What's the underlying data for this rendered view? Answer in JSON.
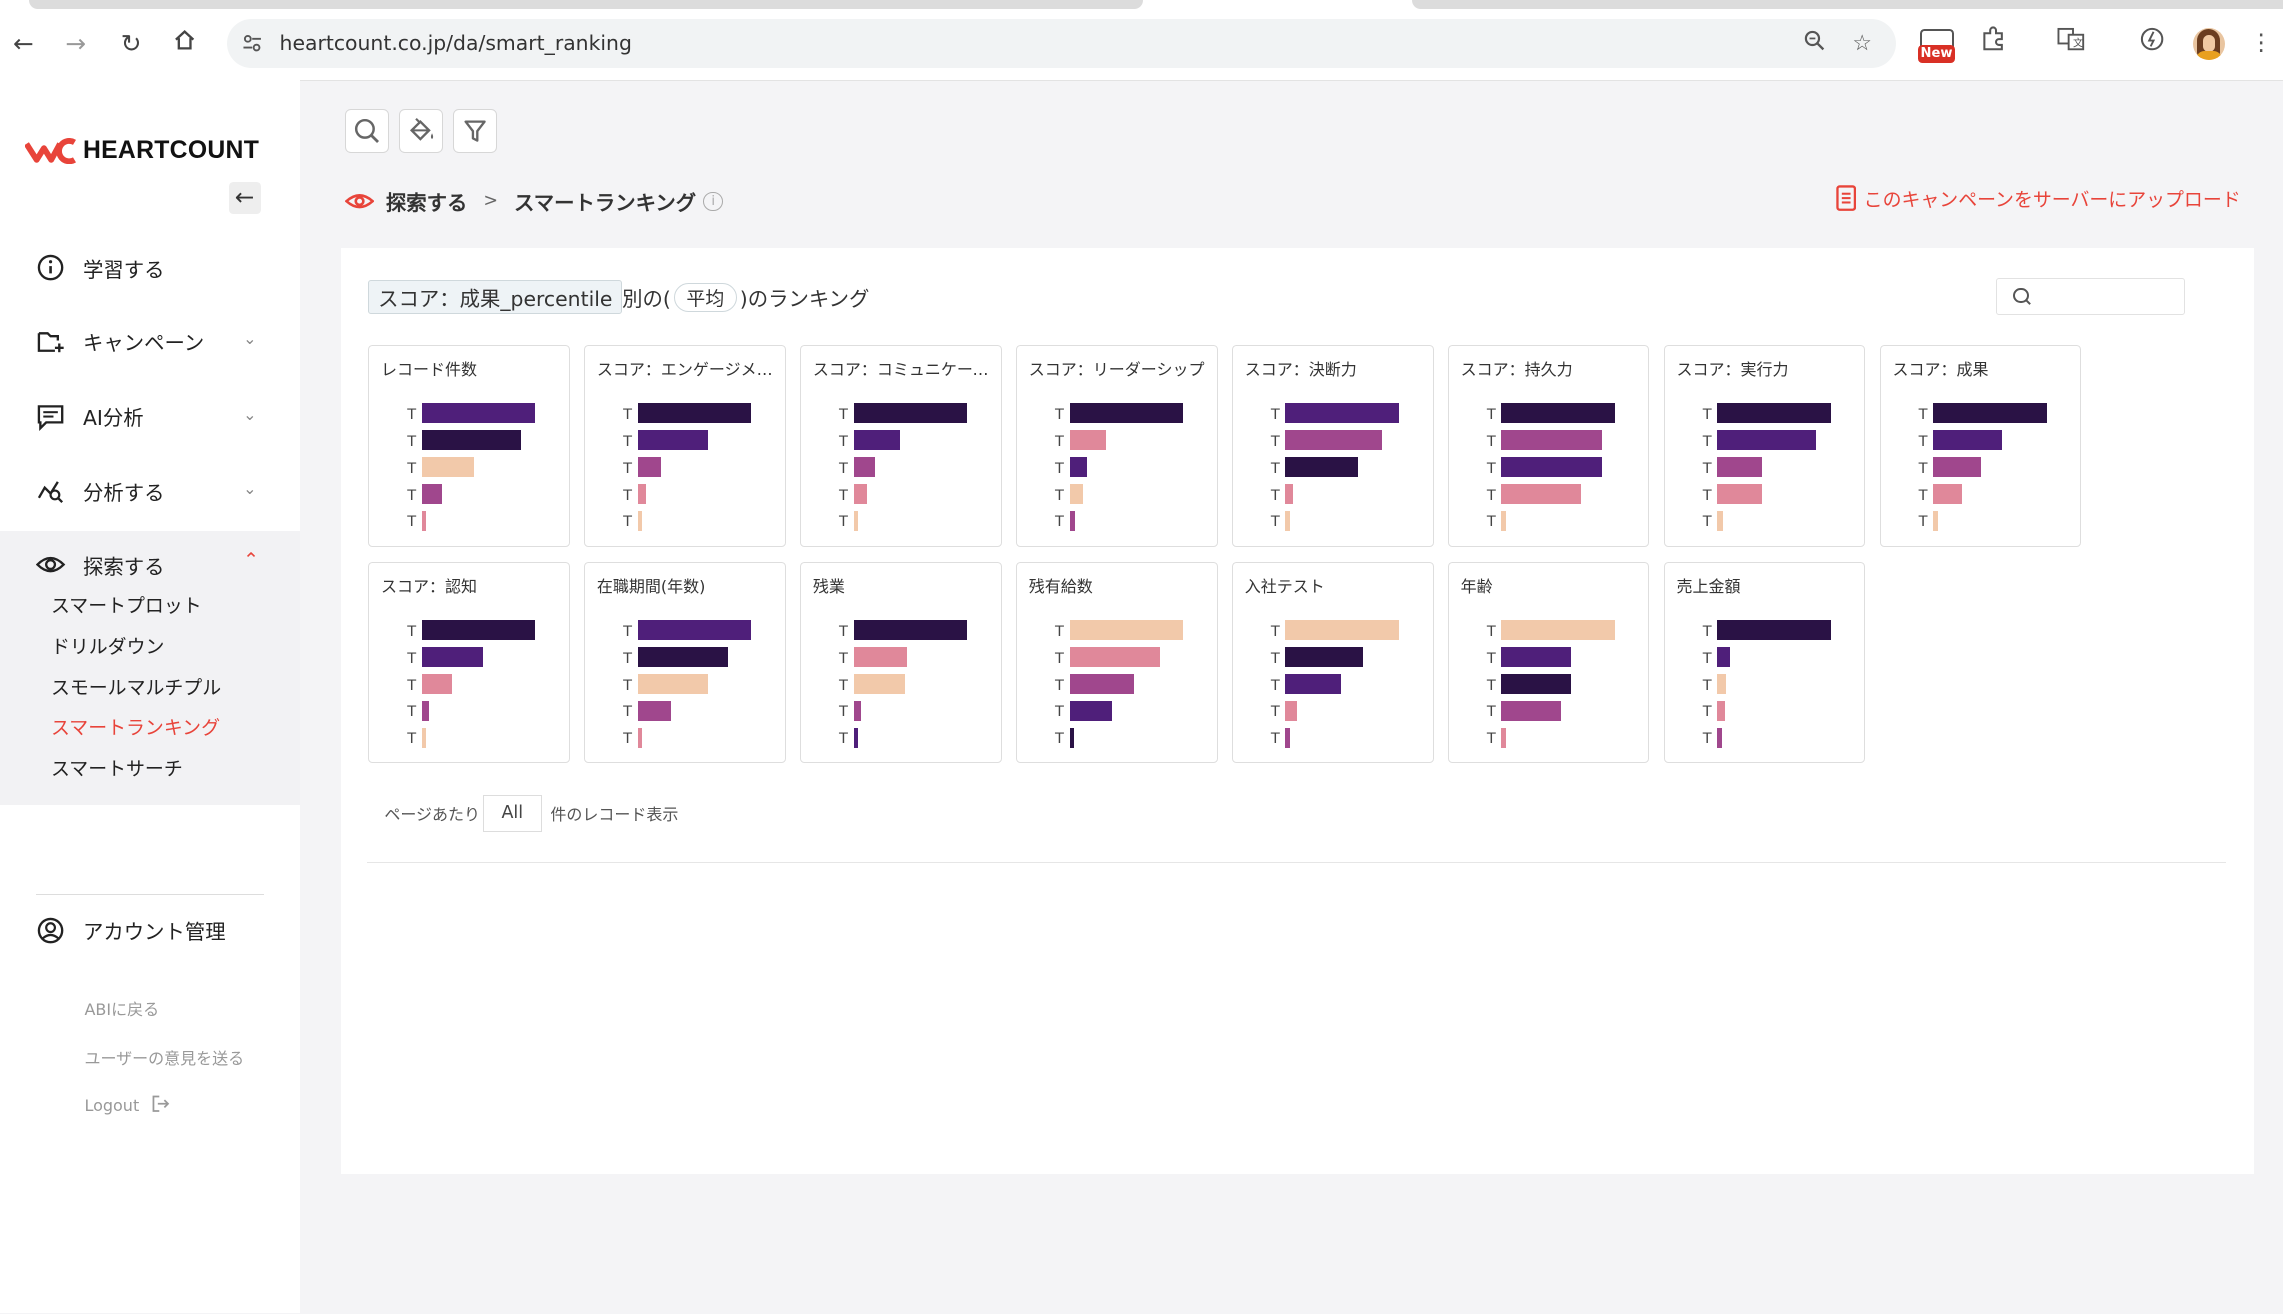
{
  "browser": {
    "url": "heartcount.co.jp/da/smart_ranking",
    "new_badge": "New"
  },
  "app": {
    "logo_text": "HEARTCOUNT",
    "menu": [
      {
        "label": "学習する"
      },
      {
        "label": "キャンペーン"
      },
      {
        "label": "AI分析"
      },
      {
        "label": "分析する"
      },
      {
        "label": "探索する"
      }
    ],
    "explore_sub": [
      {
        "label": "スマートプロット"
      },
      {
        "label": "ドリルダウン"
      },
      {
        "label": "スモールマルチプル"
      },
      {
        "label": "スマートランキング"
      },
      {
        "label": "スマートサーチ"
      }
    ],
    "account": "アカウント管理",
    "links": {
      "back": "ABIに戻る",
      "feedback": "ユーザーの意見を送る",
      "logout": "Logout"
    }
  },
  "breadcrumb": {
    "root": "探索する",
    "sep": ">",
    "current": "スマートランキング"
  },
  "upload_label": "このキャンペーンをサーバーにアップロード",
  "ranking": {
    "metric": "スコア：成果_percentile",
    "by": "別の(",
    "agg": "平均",
    "suffix": ")のランキング"
  },
  "pager": {
    "prefix": "ページあたり",
    "value": "All",
    "suffix": "件のレコード表示"
  },
  "colors": {
    "c1": "#2a1245",
    "c2": "#4f1f7a",
    "c3": "#a0478d",
    "c4": "#e0889a",
    "c5": "#f2c9aa",
    "accent": "#e8443a"
  },
  "chart_data": {
    "type": "bar",
    "note_labels": "each bar row is labeled T",
    "cards": [
      {
        "title": "レコード件数",
        "bars": [
          {
            "label": "T",
            "value": 1.0,
            "color": "#4f1f7a"
          },
          {
            "label": "T",
            "value": 0.87,
            "color": "#2a1245"
          },
          {
            "label": "T",
            "value": 0.46,
            "color": "#f2c9aa"
          },
          {
            "label": "T",
            "value": 0.18,
            "color": "#a0478d"
          },
          {
            "label": "T",
            "value": 0.04,
            "color": "#e0889a"
          }
        ]
      },
      {
        "title": "スコア：エンゲージメント",
        "bars": [
          {
            "label": "T",
            "value": 1.0,
            "color": "#2a1245"
          },
          {
            "label": "T",
            "value": 0.62,
            "color": "#4f1f7a"
          },
          {
            "label": "T",
            "value": 0.2,
            "color": "#a0478d"
          },
          {
            "label": "T",
            "value": 0.08,
            "color": "#e0889a"
          },
          {
            "label": "T",
            "value": 0.04,
            "color": "#f2c9aa"
          }
        ]
      },
      {
        "title": "スコア：コミュニケーション",
        "bars": [
          {
            "label": "T",
            "value": 1.0,
            "color": "#2a1245"
          },
          {
            "label": "T",
            "value": 0.41,
            "color": "#4f1f7a"
          },
          {
            "label": "T",
            "value": 0.19,
            "color": "#a0478d"
          },
          {
            "label": "T",
            "value": 0.12,
            "color": "#e0889a"
          },
          {
            "label": "T",
            "value": 0.04,
            "color": "#f2c9aa"
          }
        ]
      },
      {
        "title": "スコア：リーダーシップ",
        "bars": [
          {
            "label": "T",
            "value": 1.0,
            "color": "#2a1245"
          },
          {
            "label": "T",
            "value": 0.32,
            "color": "#e0889a"
          },
          {
            "label": "T",
            "value": 0.15,
            "color": "#4f1f7a"
          },
          {
            "label": "T",
            "value": 0.12,
            "color": "#f2c9aa"
          },
          {
            "label": "T",
            "value": 0.05,
            "color": "#a0478d"
          }
        ]
      },
      {
        "title": "スコア：決断力",
        "bars": [
          {
            "label": "T",
            "value": 1.0,
            "color": "#4f1f7a"
          },
          {
            "label": "T",
            "value": 0.84,
            "color": "#a0478d"
          },
          {
            "label": "T",
            "value": 0.64,
            "color": "#2a1245"
          },
          {
            "label": "T",
            "value": 0.07,
            "color": "#e0889a"
          },
          {
            "label": "T",
            "value": 0.04,
            "color": "#f2c9aa"
          }
        ]
      },
      {
        "title": "スコア：持久力",
        "bars": [
          {
            "label": "T",
            "value": 1.0,
            "color": "#2a1245"
          },
          {
            "label": "T",
            "value": 0.88,
            "color": "#a0478d"
          },
          {
            "label": "T",
            "value": 0.88,
            "color": "#4f1f7a"
          },
          {
            "label": "T",
            "value": 0.71,
            "color": "#e0889a"
          },
          {
            "label": "T",
            "value": 0.04,
            "color": "#f2c9aa"
          }
        ]
      },
      {
        "title": "スコア：実行力",
        "bars": [
          {
            "label": "T",
            "value": 1.0,
            "color": "#2a1245"
          },
          {
            "label": "T",
            "value": 0.87,
            "color": "#4f1f7a"
          },
          {
            "label": "T",
            "value": 0.4,
            "color": "#a0478d"
          },
          {
            "label": "T",
            "value": 0.4,
            "color": "#e0889a"
          },
          {
            "label": "T",
            "value": 0.05,
            "color": "#f2c9aa"
          }
        ]
      },
      {
        "title": "スコア：成果",
        "bars": [
          {
            "label": "T",
            "value": 1.0,
            "color": "#2a1245"
          },
          {
            "label": "T",
            "value": 0.6,
            "color": "#4f1f7a"
          },
          {
            "label": "T",
            "value": 0.42,
            "color": "#a0478d"
          },
          {
            "label": "T",
            "value": 0.26,
            "color": "#e0889a"
          },
          {
            "label": "T",
            "value": 0.04,
            "color": "#f2c9aa"
          }
        ]
      },
      {
        "title": "スコア：認知",
        "bars": [
          {
            "label": "T",
            "value": 1.0,
            "color": "#2a1245"
          },
          {
            "label": "T",
            "value": 0.54,
            "color": "#4f1f7a"
          },
          {
            "label": "T",
            "value": 0.27,
            "color": "#e0889a"
          },
          {
            "label": "T",
            "value": 0.06,
            "color": "#a0478d"
          },
          {
            "label": "T",
            "value": 0.04,
            "color": "#f2c9aa"
          }
        ]
      },
      {
        "title": "在職期間(年数)",
        "bars": [
          {
            "label": "T",
            "value": 1.0,
            "color": "#4f1f7a"
          },
          {
            "label": "T",
            "value": 0.8,
            "color": "#2a1245"
          },
          {
            "label": "T",
            "value": 0.62,
            "color": "#f2c9aa"
          },
          {
            "label": "T",
            "value": 0.3,
            "color": "#a0478d"
          },
          {
            "label": "T",
            "value": 0.04,
            "color": "#e0889a"
          }
        ]
      },
      {
        "title": "残業",
        "bars": [
          {
            "label": "T",
            "value": 1.0,
            "color": "#2a1245"
          },
          {
            "label": "T",
            "value": 0.48,
            "color": "#e0889a"
          },
          {
            "label": "T",
            "value": 0.45,
            "color": "#f2c9aa"
          },
          {
            "label": "T",
            "value": 0.07,
            "color": "#a0478d"
          },
          {
            "label": "T",
            "value": 0.04,
            "color": "#4f1f7a"
          }
        ]
      },
      {
        "title": "残有給数",
        "bars": [
          {
            "label": "T",
            "value": 1.0,
            "color": "#f2c9aa"
          },
          {
            "label": "T",
            "value": 0.8,
            "color": "#e0889a"
          },
          {
            "label": "T",
            "value": 0.57,
            "color": "#a0478d"
          },
          {
            "label": "T",
            "value": 0.37,
            "color": "#4f1f7a"
          },
          {
            "label": "T",
            "value": 0.04,
            "color": "#2a1245"
          }
        ]
      },
      {
        "title": "入社テスト",
        "bars": [
          {
            "label": "T",
            "value": 1.0,
            "color": "#f2c9aa"
          },
          {
            "label": "T",
            "value": 0.68,
            "color": "#2a1245"
          },
          {
            "label": "T",
            "value": 0.49,
            "color": "#4f1f7a"
          },
          {
            "label": "T",
            "value": 0.1,
            "color": "#e0889a"
          },
          {
            "label": "T",
            "value": 0.04,
            "color": "#a0478d"
          }
        ]
      },
      {
        "title": "年齢",
        "bars": [
          {
            "label": "T",
            "value": 1.0,
            "color": "#f2c9aa"
          },
          {
            "label": "T",
            "value": 0.62,
            "color": "#4f1f7a"
          },
          {
            "label": "T",
            "value": 0.62,
            "color": "#2a1245"
          },
          {
            "label": "T",
            "value": 0.53,
            "color": "#a0478d"
          },
          {
            "label": "T",
            "value": 0.04,
            "color": "#e0889a"
          }
        ]
      },
      {
        "title": "売上金額",
        "bars": [
          {
            "label": "T",
            "value": 1.0,
            "color": "#2a1245"
          },
          {
            "label": "T",
            "value": 0.12,
            "color": "#4f1f7a"
          },
          {
            "label": "T",
            "value": 0.08,
            "color": "#f2c9aa"
          },
          {
            "label": "T",
            "value": 0.06,
            "color": "#e0889a"
          },
          {
            "label": "T",
            "value": 0.04,
            "color": "#a0478d"
          }
        ]
      }
    ]
  }
}
